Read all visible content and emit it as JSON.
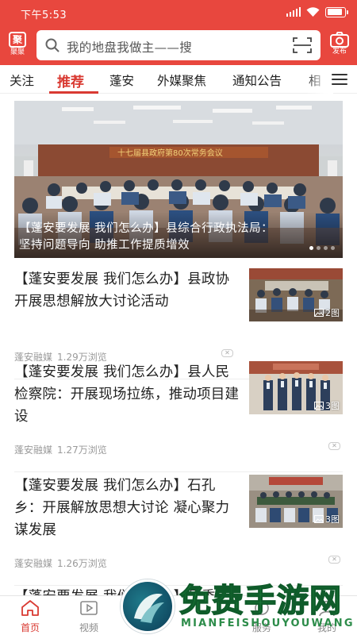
{
  "status_bar": {
    "time": "下午5:53",
    "battery_level": 0.9
  },
  "header": {
    "logo_label": "聚聚",
    "logo_glyph": "聚",
    "search_placeholder": "我的地盘我做主——搜",
    "publish_label": "发布",
    "icons": {
      "search": "search-icon",
      "scan": "scan-icon",
      "camera": "camera-icon"
    },
    "background_color": "#e8473e"
  },
  "tabs": {
    "items": [
      "关注",
      "推荐",
      "蓬安",
      "外媒聚焦",
      "通知公告",
      "相"
    ],
    "active_index": 1,
    "accent_color": "#d93a32"
  },
  "hero": {
    "caption_line1": "【蓬安要发展 我们怎么办】县综合行政执法局：",
    "caption_line2": "坚持问题导向 助推工作提质增效",
    "dots": 4,
    "active_dot": 0
  },
  "news": [
    {
      "title": "【蓬安要发展 我们怎么办】县政协开展思想解放大讨论活动",
      "source": "蓬安融媒",
      "views": "1.29万浏览",
      "image_count": "2图"
    },
    {
      "title": "【蓬安要发展 我们怎么办】县人民检察院：开展现场拉练，推动项目建设",
      "source": "蓬安融媒",
      "views": "1.27万浏览",
      "image_count": "3图"
    },
    {
      "title": "【蓬安要发展 我们怎么办】石孔乡：开展解放思想大讨论 凝心聚力谋发展",
      "source": "蓬安融媒",
      "views": "1.26万浏览",
      "image_count": "3图"
    }
  ],
  "partial_item_title": "【蓬安要发展 我们怎么办】县委",
  "bottom_nav": {
    "items": [
      {
        "label": "首页",
        "icon": "home-icon"
      },
      {
        "label": "视频",
        "icon": "video-icon"
      },
      {
        "label": "直播",
        "icon": "live-icon"
      },
      {
        "label": "服务",
        "icon": "service-icon"
      },
      {
        "label": "我的",
        "icon": "user-icon"
      }
    ],
    "active_index": 0
  },
  "watermark": {
    "title": "免费手游网",
    "subtitle": "MIANFEISHOUYOUWANG"
  }
}
